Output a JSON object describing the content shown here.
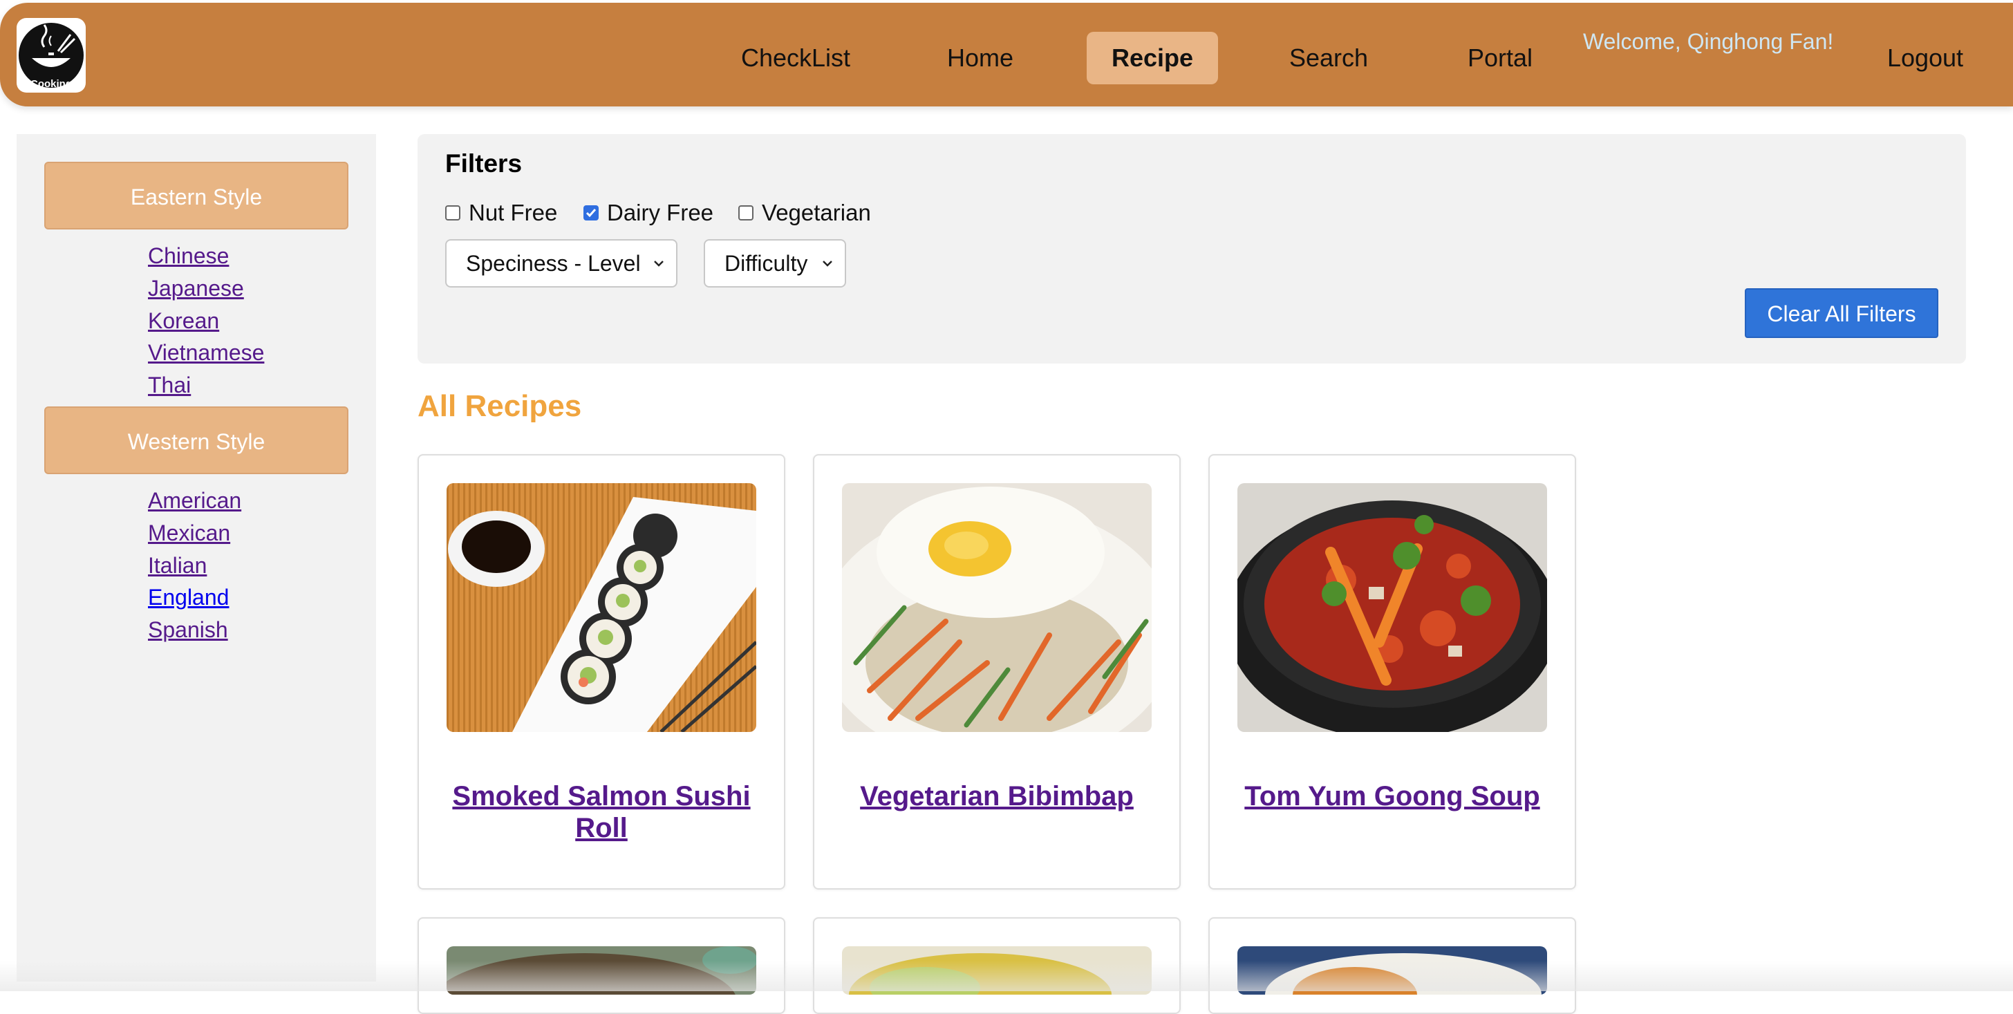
{
  "header": {
    "logo_text": "Cooking",
    "nav": [
      {
        "label": "CheckList"
      },
      {
        "label": "Home"
      },
      {
        "label": "Recipe"
      },
      {
        "label": "Search"
      },
      {
        "label": "Portal"
      }
    ],
    "welcome": "Welcome, Qinghong Fan!",
    "logout": "Logout",
    "active_nav": "Recipe",
    "colors": {
      "bar": "#c67f3f",
      "active": "#e9b586"
    }
  },
  "sidebar": {
    "groups": [
      {
        "label": "Eastern Style",
        "items": [
          "Chinese",
          "Japanese",
          "Korean",
          "Vietnamese",
          "Thai"
        ]
      },
      {
        "label": "Western Style",
        "items": [
          "American",
          "Mexican",
          "Italian",
          "England",
          "Spanish"
        ]
      }
    ]
  },
  "filters": {
    "title": "Filters",
    "checkboxes": [
      {
        "label": "Nut Free",
        "checked": false
      },
      {
        "label": "Dairy Free",
        "checked": true
      },
      {
        "label": "Vegetarian",
        "checked": false
      }
    ],
    "selects": [
      {
        "value": "Speciness - Level"
      },
      {
        "value": "Difficulty"
      }
    ],
    "clear_label": "Clear All Filters"
  },
  "recipes": {
    "title": "All Recipes",
    "items": [
      {
        "name": "Smoked Salmon Sushi Roll",
        "image": "sushi-roll-photo"
      },
      {
        "name": "Vegetarian Bibimbap",
        "image": "bibimbap-photo"
      },
      {
        "name": "Tom Yum Goong Soup",
        "image": "tom-yum-soup-photo"
      }
    ]
  }
}
